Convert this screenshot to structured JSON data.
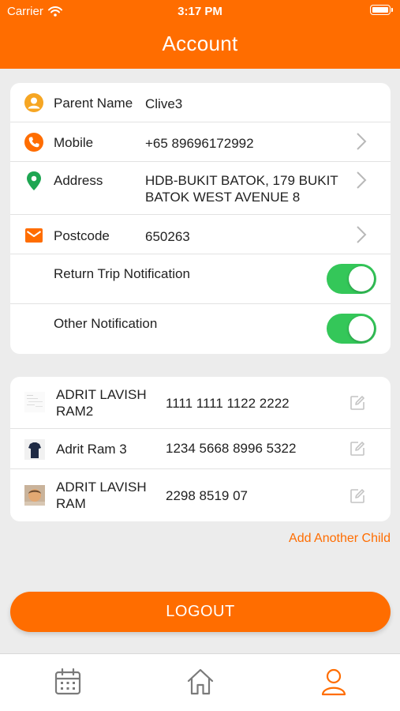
{
  "status_bar": {
    "carrier": "Carrier",
    "time": "3:17 PM"
  },
  "header": {
    "title": "Account"
  },
  "account": {
    "parent_name_label": "Parent Name",
    "parent_name_value": "Clive3",
    "mobile_label": "Mobile",
    "mobile_value": "+65 89696172992",
    "address_label": "Address",
    "address_value": "HDB-BUKIT BATOK, 179 BUKIT BATOK WEST AVENUE 8",
    "postcode_label": "Postcode",
    "postcode_value": "650263",
    "return_trip_label": "Return Trip Notification",
    "return_trip_on": true,
    "other_notification_label": "Other Notification",
    "other_notification_on": true
  },
  "children": [
    {
      "name": "ADRIT LAVISH RAM2",
      "card_number": "1111 1111 1122 2222"
    },
    {
      "name": "Adrit Ram 3",
      "card_number": "1234 5668 8996 5322"
    },
    {
      "name": "ADRIT LAVISH RAM",
      "card_number": "2298 8519 07"
    }
  ],
  "add_child_label": "Add Another Child",
  "logout_label": "LOGOUT",
  "tabbar": {
    "items": [
      "calendar-icon",
      "home-icon",
      "profile-icon"
    ],
    "active": "profile-icon"
  },
  "colors": {
    "brand": "#ff6d00",
    "toggle_on": "#34c759",
    "icon_green": "#1ea652",
    "icon_yellow": "#f6a623"
  }
}
